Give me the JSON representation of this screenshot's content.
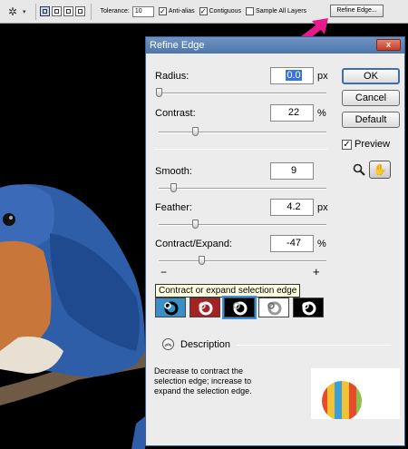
{
  "options_bar": {
    "tool_icon": "magic-wand-icon",
    "tolerance_label": "Tolerance:",
    "tolerance_value": "10",
    "anti_alias_label": "Anti-alias",
    "anti_alias_checked": true,
    "contiguous_label": "Contiguous",
    "contiguous_checked": true,
    "sample_all_layers_label": "Sample All Layers",
    "sample_all_layers_checked": false,
    "refine_edge_button": "Refine Edge..."
  },
  "dialog": {
    "title": "Refine Edge",
    "close_label": "x",
    "ok_label": "OK",
    "cancel_label": "Cancel",
    "default_label": "Default",
    "preview_label": "Preview",
    "preview_checked": true,
    "radius": {
      "label": "Radius:",
      "value": "0.0",
      "unit": "px",
      "slider": 0.0
    },
    "contrast": {
      "label": "Contrast:",
      "value": "22",
      "unit": "%",
      "slider": 0.22
    },
    "smooth": {
      "label": "Smooth:",
      "value": "9",
      "unit": "",
      "slider": 0.09
    },
    "feather": {
      "label": "Feather:",
      "value": "4.2",
      "unit": "px",
      "slider": 0.17
    },
    "contract_expand": {
      "label": "Contract/Expand:",
      "value": "-47",
      "unit": "%",
      "slider": 0.265
    },
    "minus_label": "−",
    "plus_label": "+",
    "tooltip": "Contract or expand selection edge",
    "description_label": "Description",
    "description_text": "Decrease to contract the selection edge; increase to expand the selection edge."
  },
  "colors": {
    "accent": "#3875d7",
    "titlebar": "#5a80b3",
    "arrow": "#e8198b"
  }
}
